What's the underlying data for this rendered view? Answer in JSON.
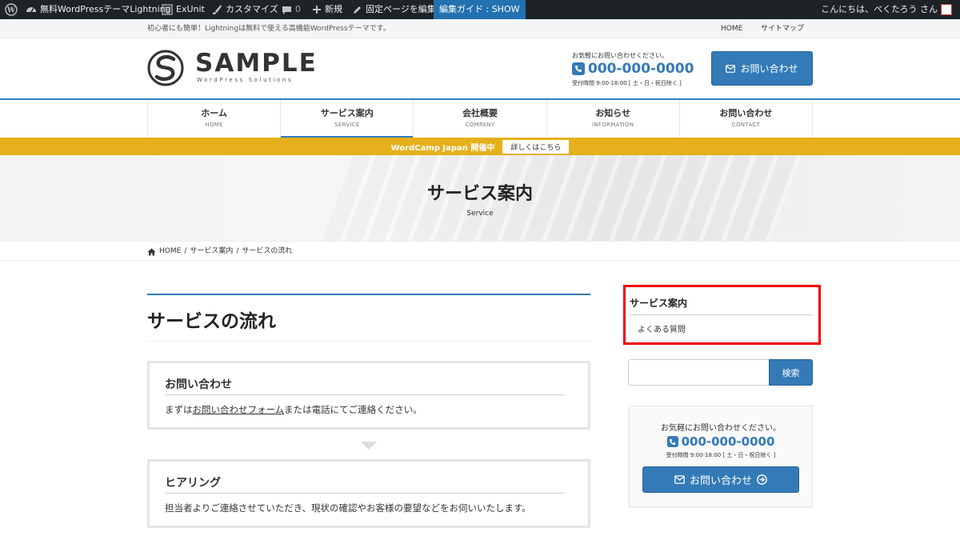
{
  "admin_bar": {
    "site_name": "無料WordPressテーマLightning",
    "exunit": "ExUnit",
    "customize": "カスタマイズ",
    "comments_count": "0",
    "new": "新規",
    "edit_page": "固定ページを編集",
    "guide": "編集ガイド : SHOW",
    "greeting": "こんにちは、べくたろう さん"
  },
  "topbar": {
    "description": "初心者にも簡単！Lightningは無料で使える高機能WordPressテーマです。",
    "links": [
      "HOME",
      "サイトマップ"
    ]
  },
  "header": {
    "logo_text": "SAMPLE",
    "logo_sub": "WordPress Solutions",
    "contact_lead": "お気軽にお問い合わせください。",
    "phone": "000-000-0000",
    "hours": "受付時間 9:00-18:00 [ 土・日・祝日除く ]",
    "contact_button": "お問い合わせ"
  },
  "nav": [
    {
      "label": "ホーム",
      "sub": "HOME"
    },
    {
      "label": "サービス案内",
      "sub": "SERVICE"
    },
    {
      "label": "会社概要",
      "sub": "COMPANY"
    },
    {
      "label": "お知らせ",
      "sub": "INFORMATION"
    },
    {
      "label": "お問い合わせ",
      "sub": "CONTACT"
    }
  ],
  "notice": {
    "text": "WordCamp Japan 開催中",
    "button": "詳しくはこちら"
  },
  "page_header": {
    "title": "サービス案内",
    "subtitle": "Service"
  },
  "breadcrumb": [
    "HOME",
    "サービス案内",
    "サービスの流れ"
  ],
  "main": {
    "title": "サービスの流れ",
    "steps": [
      {
        "title": "お問い合わせ",
        "text_before": "まずは",
        "link": "お問い合わせフォーム",
        "text_after": "または電話にてご連絡ください。"
      },
      {
        "title": "ヒアリング",
        "text": "担当者よりご連絡させていただき、現状の確認やお客様の要望などをお伺いいたします。"
      }
    ]
  },
  "sidebar": {
    "widget_title": "サービス案内",
    "widget_items": [
      "よくある質問"
    ],
    "search_button": "検索",
    "contact_lead": "お気軽にお問い合わせください。",
    "phone": "000-000-0000",
    "hours": "受付時間 9:00-18:00 [ 土・日・祝日除く ]",
    "contact_button": "お問い合わせ"
  },
  "colors": {
    "accent": "#337ab7",
    "notice": "#e6b01c",
    "admin_bar": "#1d2327",
    "highlight": "#e00000"
  }
}
